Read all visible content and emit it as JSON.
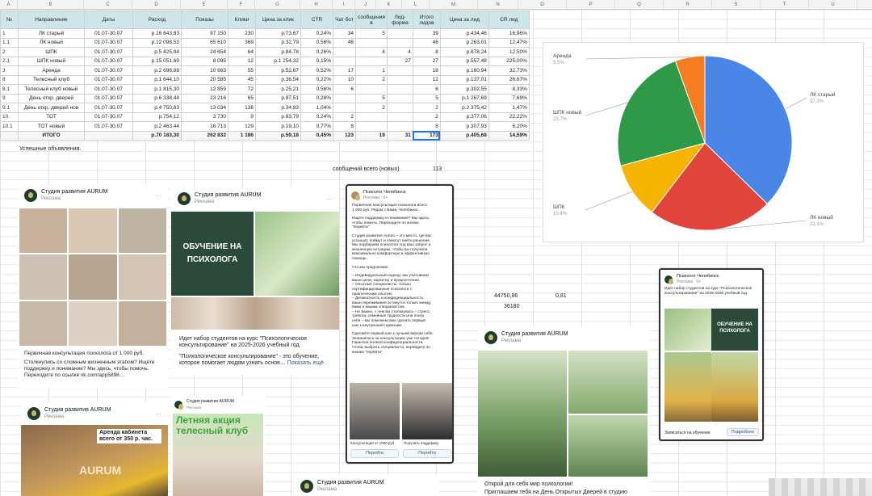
{
  "columns": [
    "A",
    "B",
    "C",
    "D",
    "E",
    "F",
    "G",
    "H",
    "I",
    "J",
    "K",
    "L",
    "M",
    "N",
    "O",
    "P",
    "Q",
    "R",
    "S",
    "T",
    "U"
  ],
  "table": {
    "headers": [
      "№",
      "Направление",
      "Даты",
      "Расход",
      "Показы",
      "Клики",
      "Цена за клик",
      "CTR",
      "Чат бот",
      "сообщения в",
      "Лид-форма",
      "Итого лидов",
      "Цена за лид",
      "CR лид"
    ],
    "rows": [
      [
        "1",
        "ЛК старый",
        "01.07-30.07",
        "р.16 843,83",
        "97 150",
        "230",
        "р.73,67",
        "0,24%",
        "34",
        "5",
        "",
        "39",
        "р.434,46",
        "16,96%"
      ],
      [
        "1.1",
        "ЛК новый",
        "01.07-30.07",
        "р.12 098,53",
        "65 610",
        "369",
        "р.32,79",
        "0,56%",
        "46",
        "",
        "",
        "46",
        "р.263,01",
        "12,47%"
      ],
      [
        "2",
        "ШПК",
        "01.07-30.07",
        "р.5 425,94",
        "24 654",
        "64",
        "р.84,78",
        "0,26%",
        "",
        "4",
        "4",
        "8",
        "р.678,24",
        "12,50%"
      ],
      [
        "2.1",
        "ШПК новый",
        "01.07-30.07",
        "р.15 051,69",
        "8 095",
        "12",
        "р.1 254,32",
        "0,15%",
        "",
        "",
        "27",
        "27",
        "р.557,48",
        "225,00%"
      ],
      [
        "3",
        "Аренда",
        "01.07-30.07",
        "р.2 696,88",
        "10 663",
        "55",
        "р.52,67",
        "0,52%",
        "17",
        "1",
        "",
        "18",
        "р.160,94",
        "32,73%"
      ],
      [
        "8",
        "Телесный клуб",
        "01.07-30.07",
        "р.1 644,10",
        "20 585",
        "45",
        "р.36,54",
        "0,22%",
        "10",
        "2",
        "",
        "12",
        "р.137,01",
        "26,67%"
      ],
      [
        "8.1",
        "Телесный клуб новый",
        "01.07-30.07",
        "р.1 815,30",
        "12 859",
        "72",
        "р.25,21",
        "0,56%",
        "6",
        "",
        "",
        "6",
        "р.302,55",
        "8,33%"
      ],
      [
        "9",
        "День откр. дверей",
        "01.07-30.07",
        "р.6 338,44",
        "23 216",
        "65",
        "р.97,51",
        "0,28%",
        "",
        "5",
        "",
        "5",
        "р.1 267,69",
        "7,69%"
      ],
      [
        "9.1",
        "День откр. дверей нов",
        "01.07-30.07",
        "р.4 750,83",
        "13 034",
        "136",
        "р.34,93",
        "1,04%",
        "",
        "2",
        "",
        "2",
        "р.2 375,42",
        "1,47%"
      ],
      [
        "10",
        "ТОТ",
        "01.07-30.07",
        "р.754,12",
        "3 730",
        "9",
        "р.83,79",
        "0,24%",
        "2",
        "",
        "",
        "2",
        "р.377,06",
        "22,22%"
      ],
      [
        "10.1",
        "ТОТ новый",
        "01.07-30.07",
        "р.2 463,44",
        "16 713",
        "129",
        "р.19,10",
        "0,77%",
        "8",
        "",
        "",
        "8",
        "р.307,93",
        "6,20%"
      ]
    ],
    "total": [
      "",
      "ИТОГО",
      "",
      "р.70 183,30",
      "262 832",
      "1 186",
      "р.59,18",
      "0,45%",
      "123",
      "19",
      "31",
      "173",
      "р.405,68",
      "14,59%"
    ]
  },
  "notes": {
    "successful": "Успешные объявления.",
    "messages_label": "сообщений всего (новых)",
    "messages_value": "113",
    "num1": "44750,86",
    "num2": "36180",
    "num3": "0,81"
  },
  "chart_data": {
    "type": "pie",
    "slices": [
      {
        "label": "ЛК старый",
        "percent": 37.3,
        "color": "#4a86e8"
      },
      {
        "label": "ЛК новый",
        "percent": 23.1,
        "color": "#e0443a"
      },
      {
        "label": "ШПК",
        "percent": 10.4,
        "color": "#f4b400"
      },
      {
        "label": "ШПК новый",
        "percent": 23.7,
        "color": "#2e9a48"
      },
      {
        "label": "Аренда",
        "percent": 5.5,
        "color": "#f57c1f"
      }
    ],
    "pct_labels": [
      "37,3%",
      "23,1%",
      "10,4%",
      "23,7%",
      "5,5%"
    ]
  },
  "ads": {
    "studio": "Студия развития AURUM",
    "ad_label": "Реклама",
    "psych": "Психолог Челябинск",
    "psych_sub": "Реклама · 0+",
    "card1_text": [
      "Первичная консультация психолога от 1 000 руб.",
      "Столкнулись со сложным жизненным этапом? Ищете",
      "поддержку и понимание? Мы здесь, чтобы помочь.",
      "Переходите по ссылке vk.com/app5898…"
    ],
    "card2_banner": "ОБУЧЕНИЕ НА ПСИХОЛОГА",
    "card2_text1": "Идет набор студентов на курс \"Психологическое консультирование\" на 2025-2026 учебный год.",
    "card2_text2": "\"Психологическое консультирование\" - это обучение, которое помогает людям узнать основ…",
    "card2_more": "Показать ещё",
    "card3_text": [
      "Первичная консультация психолога всего",
      "1 000 руб. Рядом с Вами, Челябинск.",
      "",
      "Ищете поддержку и понимание? Мы здесь,",
      "чтобы помочь. Переходите по кнопке",
      "\"перейти\"",
      "",
      "Студия развития Aurum – это место, где вас",
      "услышат, поймут и помогут найти решение.",
      "Мы подбираем психолога под ваш запрос и",
      "жизненную ситуацию, чтобы вы получили",
      "максимально комфортную и эффективную",
      "помощь.",
      "",
      "Что мы предлагаем:",
      "",
      "– Индивидуальный подход: мы учитываем",
      "ваши цели, характер и предпочтения.",
      "– Опытные специалисты: только",
      "сертифицированные психологи с",
      "практическим опытом.",
      "– Деликатность и конфиденциальность:",
      "ваши переживания останутся только между",
      "вами и вашим специалистом.",
      "– Не важно, с чем вы столкнулись – стресс,",
      "тревога, семейные трудности или поиск",
      "себя – мы поможем вам сделать первый",
      "шаг к внутренней гармонии.",
      "",
      "Сделайте первый шаг к лучшей версии себя.",
      "Запишитесь на консультацию уже сегодня!",
      "Гарантия полной конфиденциальности.",
      "Чтобы выбрать специалиста, перейдите по",
      "кнопке \"перейти\""
    ],
    "card3_cap1": "Консультация от 1000 руб",
    "card3_cap2": "Получить поддержку",
    "card3_btn": "Перейти",
    "card4_text": "Идет набор студентов на курс \"Психологическое консультирование\" на 2025-2026 учебный год.",
    "card4_banner": "ОБУЧЕНИЕ НА ПСИХОЛОГА",
    "card4_caption": "Записаться на обучение",
    "card4_btn": "Подробнее",
    "card5_banner": "Аренда кабинета всего от 350 р. час.",
    "card5_sign": "AURUM",
    "card6_banner": "Летняя акция телесный клуб",
    "card7_text1": "Открой для себя мир психологии!",
    "card7_text2": "Приглашаем тебя на День Открытых Дверей в студию"
  }
}
